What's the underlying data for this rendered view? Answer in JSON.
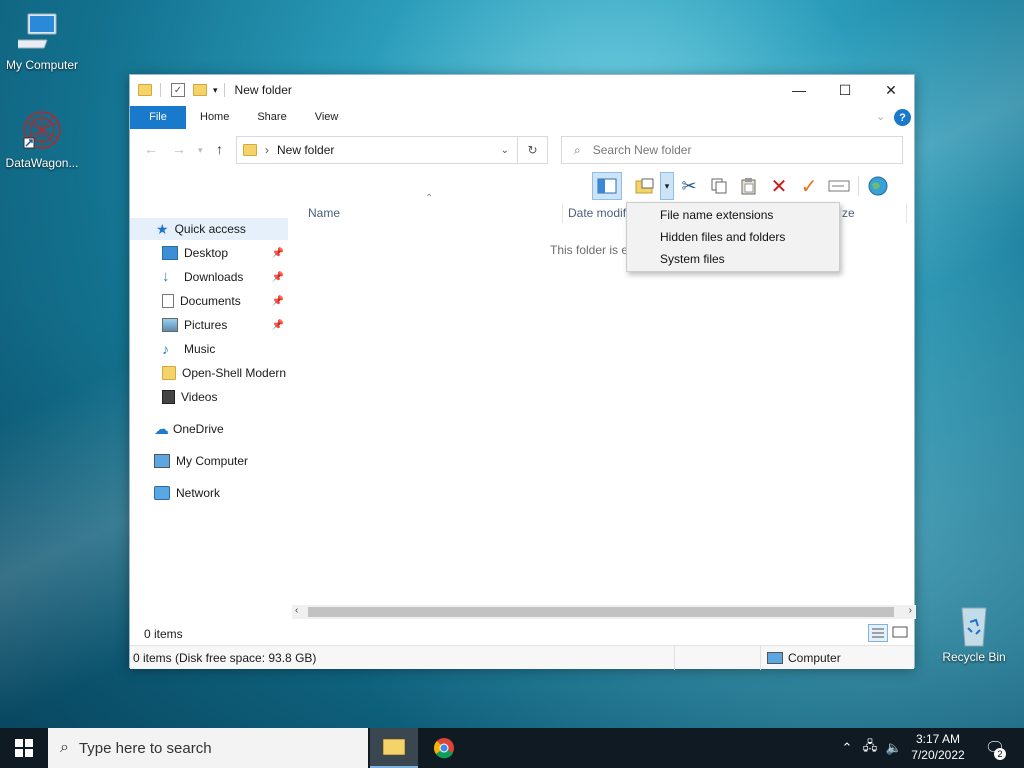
{
  "desktop": {
    "icons": [
      {
        "label": "My Computer"
      },
      {
        "label": "DataWagon..."
      },
      {
        "label": "Recycle Bin"
      }
    ]
  },
  "window": {
    "title": "New folder",
    "controls": {
      "minimize": "—",
      "maximize": "☐",
      "close": "✕"
    },
    "ribbon_tabs": [
      "File",
      "Home",
      "Share",
      "View"
    ],
    "address": {
      "path": "New folder",
      "separator": "›"
    },
    "search": {
      "placeholder": "Search New folder"
    },
    "nav": {
      "quick_access": "Quick access",
      "items": [
        "Desktop",
        "Downloads",
        "Documents",
        "Pictures",
        "Music",
        "Open-Shell Modern",
        "Videos"
      ],
      "onedrive": "OneDrive",
      "my_computer": "My Computer",
      "network": "Network"
    },
    "columns": {
      "name": "Name",
      "date": "Date modifi",
      "size": "ze"
    },
    "empty_text": "This folder is e",
    "item_count": "0 items",
    "status_left": "0 items (Disk free space: 93.8 GB)",
    "status_right": "Computer"
  },
  "menu": {
    "items": [
      "File name extensions",
      "Hidden files and folders",
      "System files"
    ]
  },
  "taskbar": {
    "search_placeholder": "Type here to search",
    "time": "3:17 AM",
    "date": "7/20/2022",
    "notification_count": "2"
  },
  "colors": {
    "accent": "#1979ca",
    "taskbar": "#0f1a22",
    "selection": "#e5f0fb"
  }
}
